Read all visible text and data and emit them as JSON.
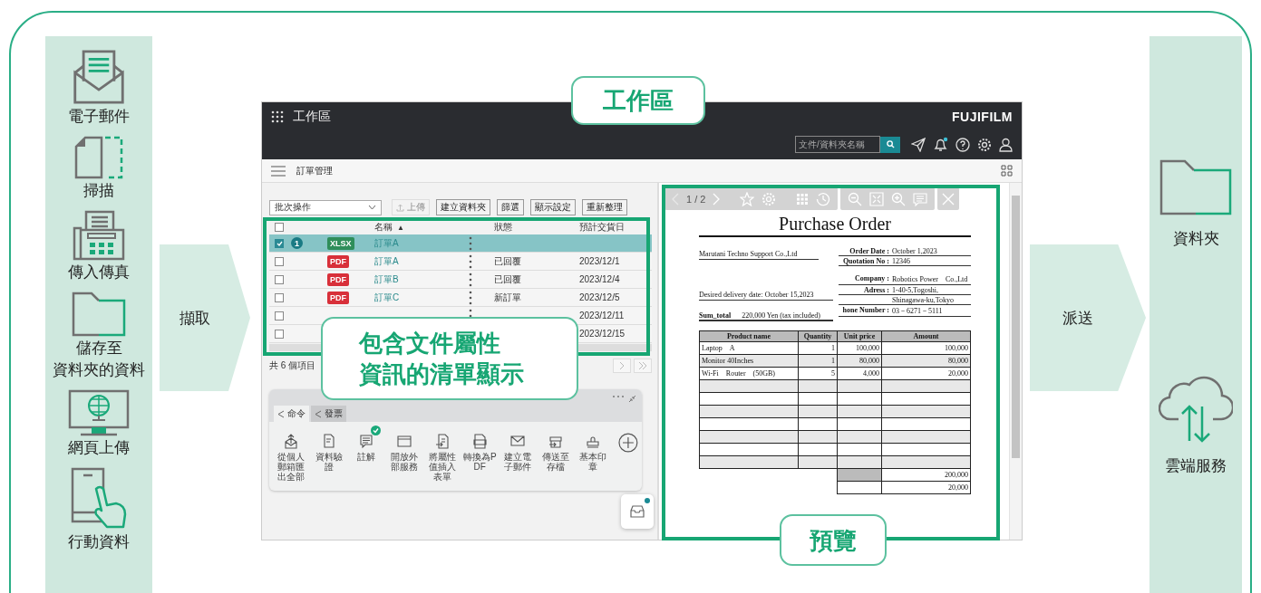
{
  "sources": [
    {
      "kind": "email",
      "label_lines": [
        "電子郵件"
      ]
    },
    {
      "kind": "scan",
      "label_lines": [
        "掃描"
      ]
    },
    {
      "kind": "fax",
      "label_lines": [
        "傳入傳真"
      ]
    },
    {
      "kind": "folder",
      "label_lines": [
        "儲存至",
        "資料夾的資料"
      ]
    },
    {
      "kind": "web",
      "label_lines": [
        "網頁上傳"
      ]
    },
    {
      "kind": "mobile",
      "label_lines": [
        "行動資料"
      ]
    }
  ],
  "capture_label": "擷取",
  "deliver_label": "派送",
  "destinations": [
    {
      "kind": "folder",
      "label": "資料夾"
    },
    {
      "kind": "cloud",
      "label": "雲端服務"
    }
  ],
  "callouts": {
    "workspace": "工作區",
    "list": [
      "包含文件屬性",
      "資訊的清單顯示"
    ],
    "preview": "預覽"
  },
  "app": {
    "title": "工作區",
    "logo": "FUJIFILM",
    "search": {
      "placeholder": "文件/資料夾名稱"
    },
    "notification": true,
    "page_title": "訂單管理",
    "batch_select": "批次操作",
    "buttons": [
      {
        "label": "上傳",
        "disabled": true
      },
      {
        "label": "建立資料夾",
        "disabled": false
      },
      {
        "label": "篩選",
        "disabled": false
      },
      {
        "label": "顯示設定",
        "disabled": false
      },
      {
        "label": "重新整理",
        "disabled": false
      }
    ],
    "all_checked": false,
    "columns": [
      {
        "label": "名稱",
        "sort_indicator": "▲"
      },
      {
        "label": "狀態"
      },
      {
        "label": "預計交貨日"
      }
    ],
    "rows": [
      {
        "checked": true,
        "selected": true,
        "count": "1",
        "type": "XLSX",
        "name": "訂單A"
      },
      {
        "checked": false,
        "selected": false,
        "type": "PDF",
        "name": "訂單A",
        "status": "已回覆",
        "date": "2023/12/1"
      },
      {
        "checked": false,
        "selected": false,
        "type": "PDF",
        "name": "訂單B",
        "status": "已回覆",
        "date": "2023/12/4"
      },
      {
        "checked": false,
        "selected": false,
        "type": "PDF",
        "name": "訂單C",
        "status": "新訂單",
        "date": "2023/12/5"
      },
      {
        "checked": false,
        "selected": false,
        "date": "2023/12/11"
      },
      {
        "checked": false,
        "selected": false,
        "date": "2023/12/15"
      }
    ],
    "item_count": "共 6 個項目",
    "tabs": [
      {
        "label": "命令",
        "selected": true
      },
      {
        "label": "發票",
        "selected": false
      }
    ],
    "commands": [
      {
        "kind": "export",
        "label": "從個人郵箱匯出全部",
        "checked": false
      },
      {
        "kind": "verify",
        "label": "資料驗證",
        "checked": false
      },
      {
        "kind": "comment",
        "label": "註解",
        "checked": true
      },
      {
        "kind": "window",
        "label": "開放外部服務",
        "checked": false
      },
      {
        "kind": "form",
        "label": "將屬性值插入表單",
        "checked": false
      },
      {
        "kind": "pdf",
        "label": "轉換為PDF",
        "checked": false
      },
      {
        "kind": "mail",
        "label": "建立電子郵件",
        "checked": false
      },
      {
        "kind": "archive",
        "label": "傳送至存檔",
        "checked": false
      },
      {
        "kind": "stamp",
        "label": "基本印章",
        "checked": false
      }
    ],
    "inbox_notification": true,
    "preview": {
      "page": "1 / 2",
      "document": {
        "title": "Purchase Order",
        "customer": "Marutani Techno Support Co.,Ltd",
        "delivery": "Desired delivery date: October 15,2023",
        "sum_label": "Sum_total",
        "sum_value": "220,000 Yen (tax included)",
        "order_fields": [
          {
            "label": "Order Date :",
            "value": "October 1,2023"
          },
          {
            "label": "Quotation No :",
            "value": "12346"
          }
        ],
        "company_fields": [
          {
            "label": "Company :",
            "value": "Robotics Power　Co.,Ltd"
          },
          {
            "label": "Adress :",
            "value": "1-40-5,Togoshi,"
          },
          {
            "value": "Shinagawa-ku,Tokyo"
          },
          {
            "label": "hone Number :",
            "value": "03－6271－5111"
          }
        ],
        "columns": [
          "Product name",
          "Quantity",
          "Unit price",
          "Amount"
        ],
        "rows": [
          [
            "Laptop　A",
            "1",
            "100,000",
            "100,000"
          ],
          [
            "Monitor 40Inches",
            "1",
            "80,000",
            "80,000"
          ],
          [
            "Wi-Fi　Router　(50GB)",
            "5",
            "4,000",
            "20,000"
          ]
        ],
        "totals": [
          "200,000",
          "20,000"
        ]
      }
    }
  }
}
